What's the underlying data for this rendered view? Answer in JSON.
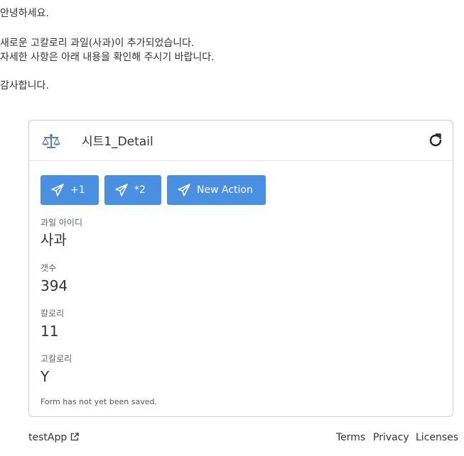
{
  "email": {
    "greeting": "안녕하세요.",
    "body_line1": "새로운 고칼로리 과일(사과)이 추가되었습니다.",
    "body_line2": "자세한 사항은 아래 내용을 확인해 주시기 바랍니다.",
    "closing": "감사합니다."
  },
  "card": {
    "title": "시트1_Detail",
    "header_icon": "scale-icon",
    "refresh_icon": "refresh-icon",
    "actions": [
      {
        "label": "+1",
        "icon": "send-icon"
      },
      {
        "label": "*2",
        "icon": "send-icon"
      },
      {
        "label": "New Action",
        "icon": "send-icon"
      }
    ],
    "fields": [
      {
        "label": "과일 아이디",
        "value": "사과"
      },
      {
        "label": "갯수",
        "value": "394"
      },
      {
        "label": "칼로리",
        "value": "11"
      },
      {
        "label": "고칼로리",
        "value": "Y"
      }
    ],
    "status_note": "Form has not yet been saved."
  },
  "footer": {
    "app_name": "testApp",
    "app_icon": "external-link-icon",
    "links": [
      "Terms",
      "Privacy",
      "Licenses"
    ]
  },
  "colors": {
    "accent": "#4a90e2",
    "border": "#cfcfcf",
    "text": "#333333"
  }
}
